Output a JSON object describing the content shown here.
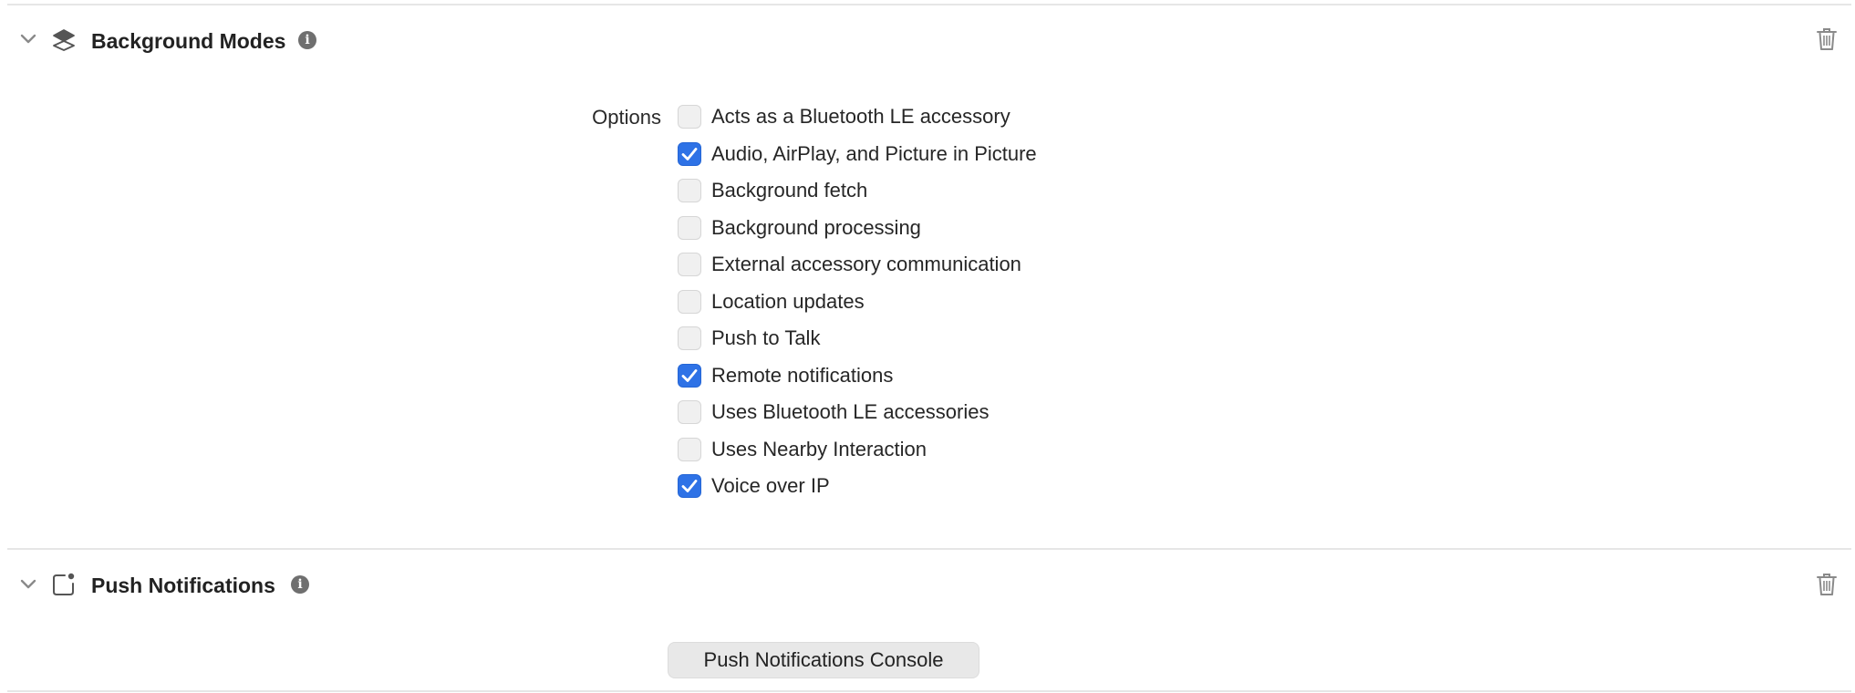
{
  "background_modes": {
    "title": "Background Modes",
    "options_label": "Options",
    "options": [
      {
        "label": "Acts as a Bluetooth LE accessory",
        "checked": false
      },
      {
        "label": "Audio, AirPlay, and Picture in Picture",
        "checked": true
      },
      {
        "label": "Background fetch",
        "checked": false
      },
      {
        "label": "Background processing",
        "checked": false
      },
      {
        "label": "External accessory communication",
        "checked": false
      },
      {
        "label": "Location updates",
        "checked": false
      },
      {
        "label": "Push to Talk",
        "checked": false
      },
      {
        "label": "Remote notifications",
        "checked": true
      },
      {
        "label": "Uses Bluetooth LE accessories",
        "checked": false
      },
      {
        "label": "Uses Nearby Interaction",
        "checked": false
      },
      {
        "label": "Voice over IP",
        "checked": true
      }
    ]
  },
  "push_notifications": {
    "title": "Push Notifications",
    "console_button": "Push Notifications Console"
  },
  "colors": {
    "checkbox_checked": "#2e72e6",
    "divider": "#e6e6e6"
  },
  "icons": {
    "collapse": "chevron-down-icon",
    "background_modes": "layers-icon",
    "push_notifications": "notification-badge-icon",
    "info": "info-icon",
    "delete": "trash-icon"
  }
}
